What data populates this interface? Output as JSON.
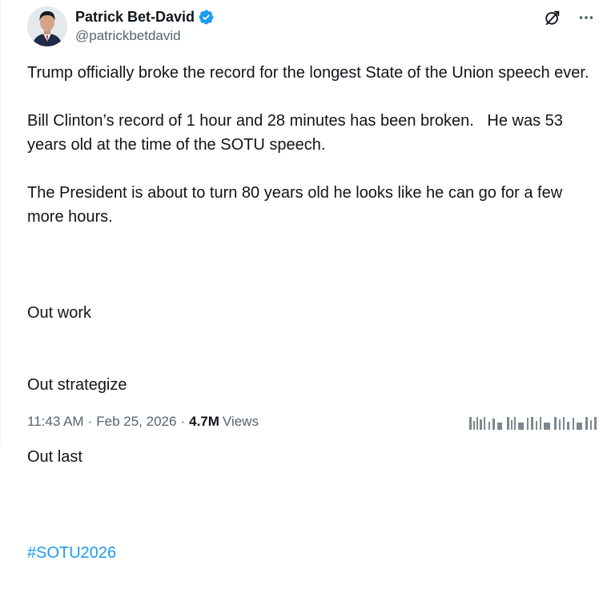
{
  "author": {
    "display_name": "Patrick Bet-David",
    "handle": "@patrickbetdavid",
    "verified_color": "#1d9bf0"
  },
  "actions": {
    "grok_icon": "grok-icon",
    "more_icon": "more-options-icon"
  },
  "post": {
    "paragraphs": [
      "Trump officially broke the record for the longest State of the Union speech ever.",
      "Bill Clinton’s record of 1 hour and 28 minutes has been broken.   He was 53 years old at the time of the SOTU speech.",
      "The President is about to turn 80 years old he looks like he can go for a few more hours."
    ],
    "closing_lines": [
      "Out work",
      "Out strategize",
      "Out last"
    ],
    "hashtag": "#SOTU2026"
  },
  "meta": {
    "time": "11:43 AM",
    "separator": "·",
    "date": "Feb 25, 2026",
    "views_count": "4.7M",
    "views_label": "Views"
  },
  "colors": {
    "text": "#0f1419",
    "secondary": "#536471",
    "link": "#1d9bf0"
  }
}
